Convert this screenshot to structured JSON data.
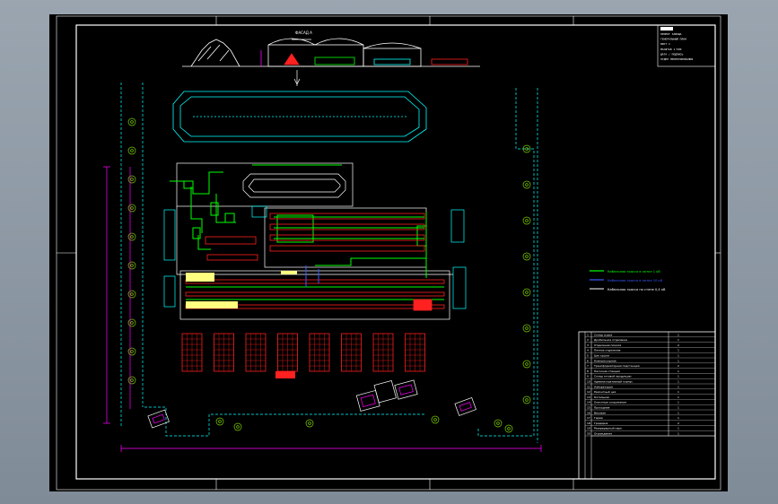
{
  "drawing": {
    "title_block_lines": [
      "ПРОЕКТ ЗАВОДА",
      "ГЕНЕРАЛЬНЫЙ ПЛАН",
      "ЛИСТ 1",
      "МАСШТАБ 1:500",
      "ДАТА / ПОДПИСЬ",
      "ОТДЕЛ ПРОЕКТИРОВАНИЯ"
    ],
    "legend": [
      {
        "label": "Кабельная трасса в лотке 1 кВ",
        "color": "#00ff00"
      },
      {
        "label": "Кабельная трасса в лотке 10 кВ",
        "color": "#3b5bff"
      },
      {
        "label": "Кабельная трасса по стене 0,4 кВ",
        "color": "#ffffff"
      }
    ],
    "elevation_label": "ФАСАД А",
    "schedule": {
      "rows": [
        {
          "no": "1",
          "name": "Склад сырья",
          "qty": "1"
        },
        {
          "no": "2",
          "name": "Дробильное отделение",
          "qty": "1"
        },
        {
          "no": "3",
          "name": "Отделение помола",
          "qty": "2"
        },
        {
          "no": "4",
          "name": "Печное отделение",
          "qty": "1"
        },
        {
          "no": "5",
          "name": "Цех сушки",
          "qty": "1"
        },
        {
          "no": "6",
          "name": "Компрессорная",
          "qty": "1"
        },
        {
          "no": "7",
          "name": "Трансформаторная подстанция",
          "qty": "2"
        },
        {
          "no": "8",
          "name": "Насосная станция",
          "qty": "1"
        },
        {
          "no": "9",
          "name": "Склад готовой продукции",
          "qty": "1"
        },
        {
          "no": "10",
          "name": "Административный корпус",
          "qty": "1"
        },
        {
          "no": "11",
          "name": "Лаборатория",
          "qty": "1"
        },
        {
          "no": "12",
          "name": "Ремонтный цех",
          "qty": "1"
        },
        {
          "no": "13",
          "name": "Котельная",
          "qty": "1"
        },
        {
          "no": "14",
          "name": "Очистные сооружения",
          "qty": "1"
        },
        {
          "no": "15",
          "name": "Проходная",
          "qty": "1"
        },
        {
          "no": "16",
          "name": "Весовая",
          "qty": "1"
        },
        {
          "no": "17",
          "name": "Гараж",
          "qty": "1"
        },
        {
          "no": "18",
          "name": "Градирня",
          "qty": "2"
        },
        {
          "no": "19",
          "name": "Резервуарный парк",
          "qty": "1"
        },
        {
          "no": "20",
          "name": "Ограждение",
          "qty": "1"
        }
      ]
    }
  }
}
